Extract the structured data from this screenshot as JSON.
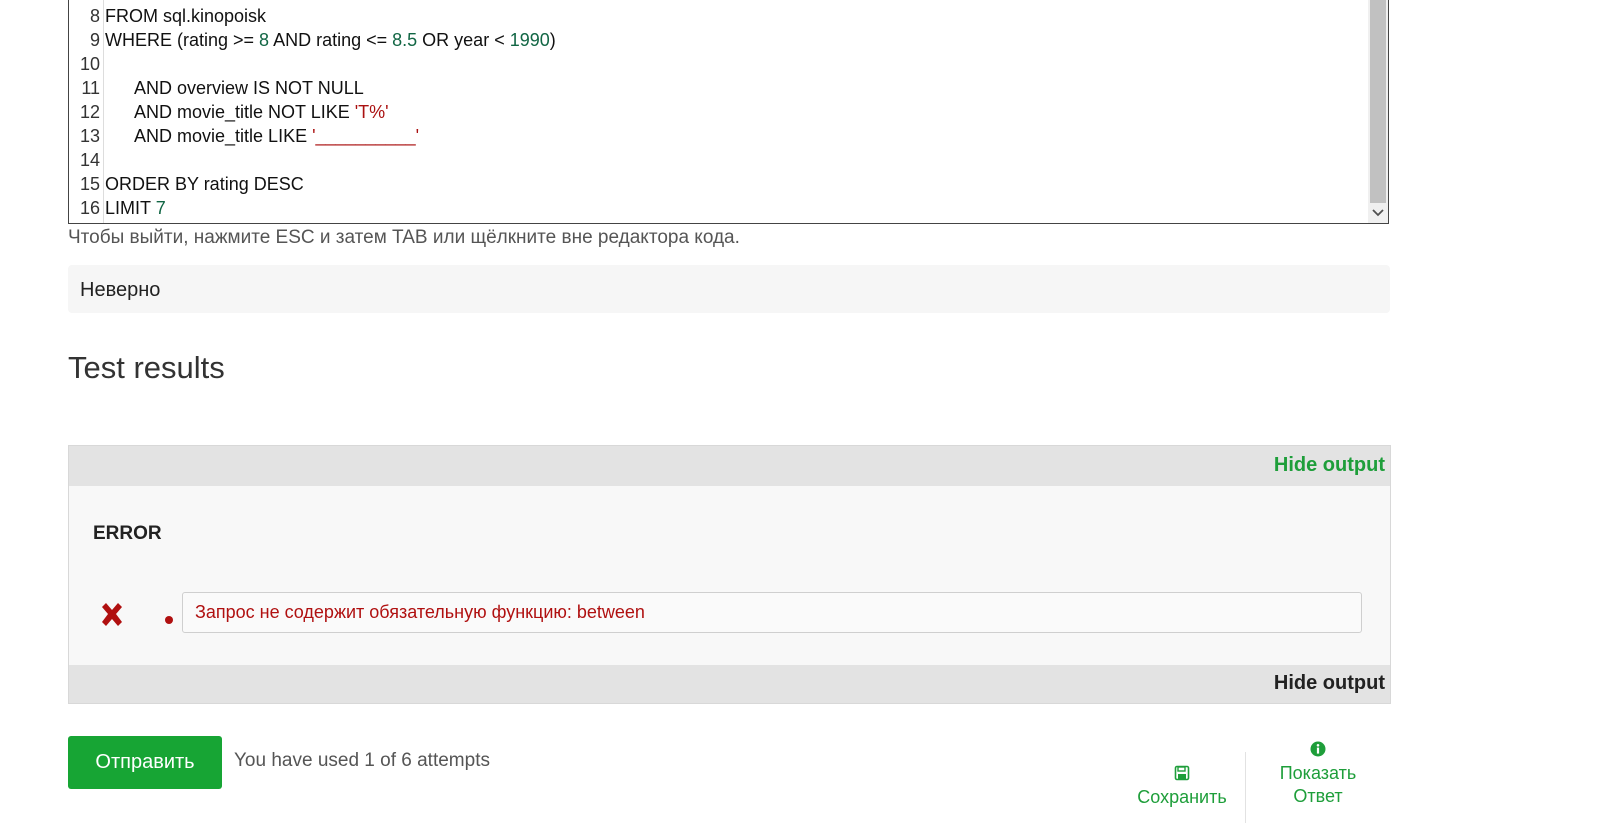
{
  "editor": {
    "lines": [
      {
        "n": "8",
        "parts": [
          {
            "t": "FROM sql.kinopoisk",
            "c": ""
          }
        ]
      },
      {
        "n": "9",
        "parts": [
          {
            "t": "WHERE (rating >= ",
            "c": ""
          },
          {
            "t": "8",
            "c": "num"
          },
          {
            "t": " AND rating <= ",
            "c": ""
          },
          {
            "t": "8.5",
            "c": "num"
          },
          {
            "t": " OR year < ",
            "c": ""
          },
          {
            "t": "1990",
            "c": "num"
          },
          {
            "t": ")",
            "c": ""
          }
        ]
      },
      {
        "n": "10",
        "parts": []
      },
      {
        "n": "11",
        "parts": [
          {
            "t": "      AND overview IS NOT NULL",
            "c": ""
          }
        ]
      },
      {
        "n": "12",
        "parts": [
          {
            "t": "      AND movie_title NOT LIKE ",
            "c": ""
          },
          {
            "t": "'T%'",
            "c": "str"
          }
        ]
      },
      {
        "n": "13",
        "parts": [
          {
            "t": "      AND movie_title LIKE ",
            "c": ""
          },
          {
            "t": "'__________'",
            "c": "str"
          }
        ]
      },
      {
        "n": "14",
        "parts": []
      },
      {
        "n": "15",
        "parts": [
          {
            "t": "ORDER BY rating DESC",
            "c": ""
          }
        ]
      },
      {
        "n": "16",
        "parts": [
          {
            "t": "LIMIT ",
            "c": ""
          },
          {
            "t": "7",
            "c": "num"
          }
        ]
      }
    ],
    "hint": "Чтобы выйти, нажмите ESC и затем TAB или щёлкните вне редактора кода."
  },
  "verdict": "Неверно",
  "results": {
    "title": "Test results",
    "hide_output_top": "Hide output",
    "hide_output_bottom": "Hide output",
    "error_label": "ERROR",
    "error_message": "Запрос не содержит обязательную функцию: between"
  },
  "footer": {
    "submit_label": "Отправить",
    "attempts_text": "You have used 1 of 6 attempts",
    "save_label": "Сохранить",
    "show_answer_label_1": "Показать",
    "show_answer_label_2": "Ответ"
  },
  "colors": {
    "accent_green": "#17a534",
    "link_green": "#1e9e3a",
    "error_red": "#b01010",
    "number_green": "#116644",
    "string_red": "#aa1111"
  },
  "icons": {
    "save": "floppy-disk-icon",
    "answer": "info-circle-icon",
    "error": "x-mark-icon"
  }
}
